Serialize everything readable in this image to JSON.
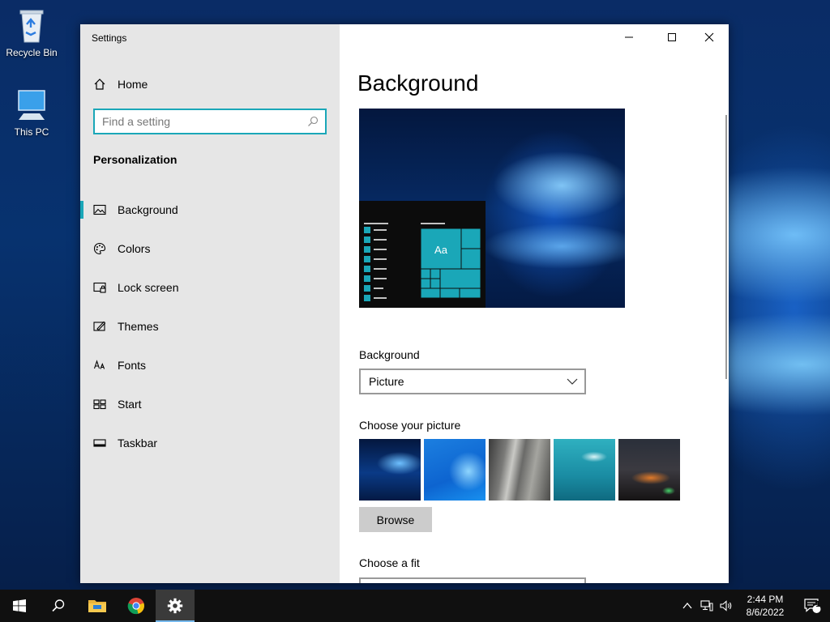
{
  "desktop": {
    "icons": [
      {
        "label": "Recycle Bin"
      },
      {
        "label": "This PC"
      }
    ]
  },
  "window": {
    "app_title": "Settings",
    "controls": {
      "minimize": "minimize-icon",
      "maximize": "maximize-icon",
      "close": "close-icon"
    }
  },
  "sidebar": {
    "home_label": "Home",
    "search_placeholder": "Find a setting",
    "section_heading": "Personalization",
    "items": [
      {
        "label": "Background",
        "icon": "picture-icon",
        "active": true
      },
      {
        "label": "Colors",
        "icon": "palette-icon"
      },
      {
        "label": "Lock screen",
        "icon": "lock-screen-icon"
      },
      {
        "label": "Themes",
        "icon": "themes-icon"
      },
      {
        "label": "Fonts",
        "icon": "fonts-icon"
      },
      {
        "label": "Start",
        "icon": "start-icon"
      },
      {
        "label": "Taskbar",
        "icon": "taskbar-icon"
      }
    ]
  },
  "main": {
    "title": "Background",
    "preview": {
      "sample_text": "Aa"
    },
    "background_label": "Background",
    "background_value": "Picture",
    "choose_picture_label": "Choose your picture",
    "browse_label": "Browse",
    "choose_fit_label": "Choose a fit"
  },
  "taskbar": {
    "time": "2:44 PM",
    "date": "8/6/2022",
    "notification_count": "1"
  },
  "colors": {
    "accent": "#1aa7b8",
    "sidebar_bg": "#e6e6e6",
    "taskbar_bg": "#101010"
  }
}
